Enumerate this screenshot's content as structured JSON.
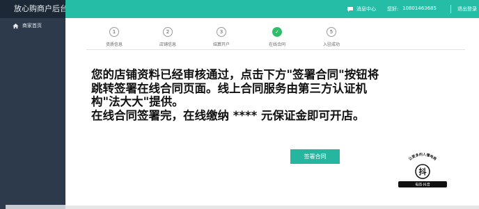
{
  "sidebar": {
    "brand": "放心购商户后台",
    "items": [
      {
        "label": "商家首页",
        "icon": "home-icon"
      }
    ]
  },
  "topbar": {
    "message_center": "消息中心",
    "greeting": "您好:",
    "phone": "10801463685",
    "logout": "退出登录",
    "accent_color": "#26bda6"
  },
  "steps": [
    {
      "number": "1",
      "label": "资质信息",
      "active": false
    },
    {
      "number": "2",
      "label": "店铺信息",
      "active": false
    },
    {
      "number": "3",
      "label": "结算开户",
      "active": false
    },
    {
      "number": "✓",
      "label": "在线合同",
      "active": true
    },
    {
      "number": "5",
      "label": "入驻成功",
      "active": false
    }
  ],
  "notice": {
    "line1": "您的店铺资料已经审核通过，点击下方\"签署合同\"按钮将",
    "line2": "跳转签署在线合同页面。线上合同服务由第三方认证机",
    "line3": "构\"法大大\"提供。",
    "line4": "在线合同签署完，在线缴纳 **** 元保证金即可开店。"
  },
  "sign_button": {
    "label": "签署合同"
  },
  "watermark": {
    "arc_text": "让更多的人懂电商",
    "center_char": "抖",
    "badge_text": "电商·抖音"
  }
}
